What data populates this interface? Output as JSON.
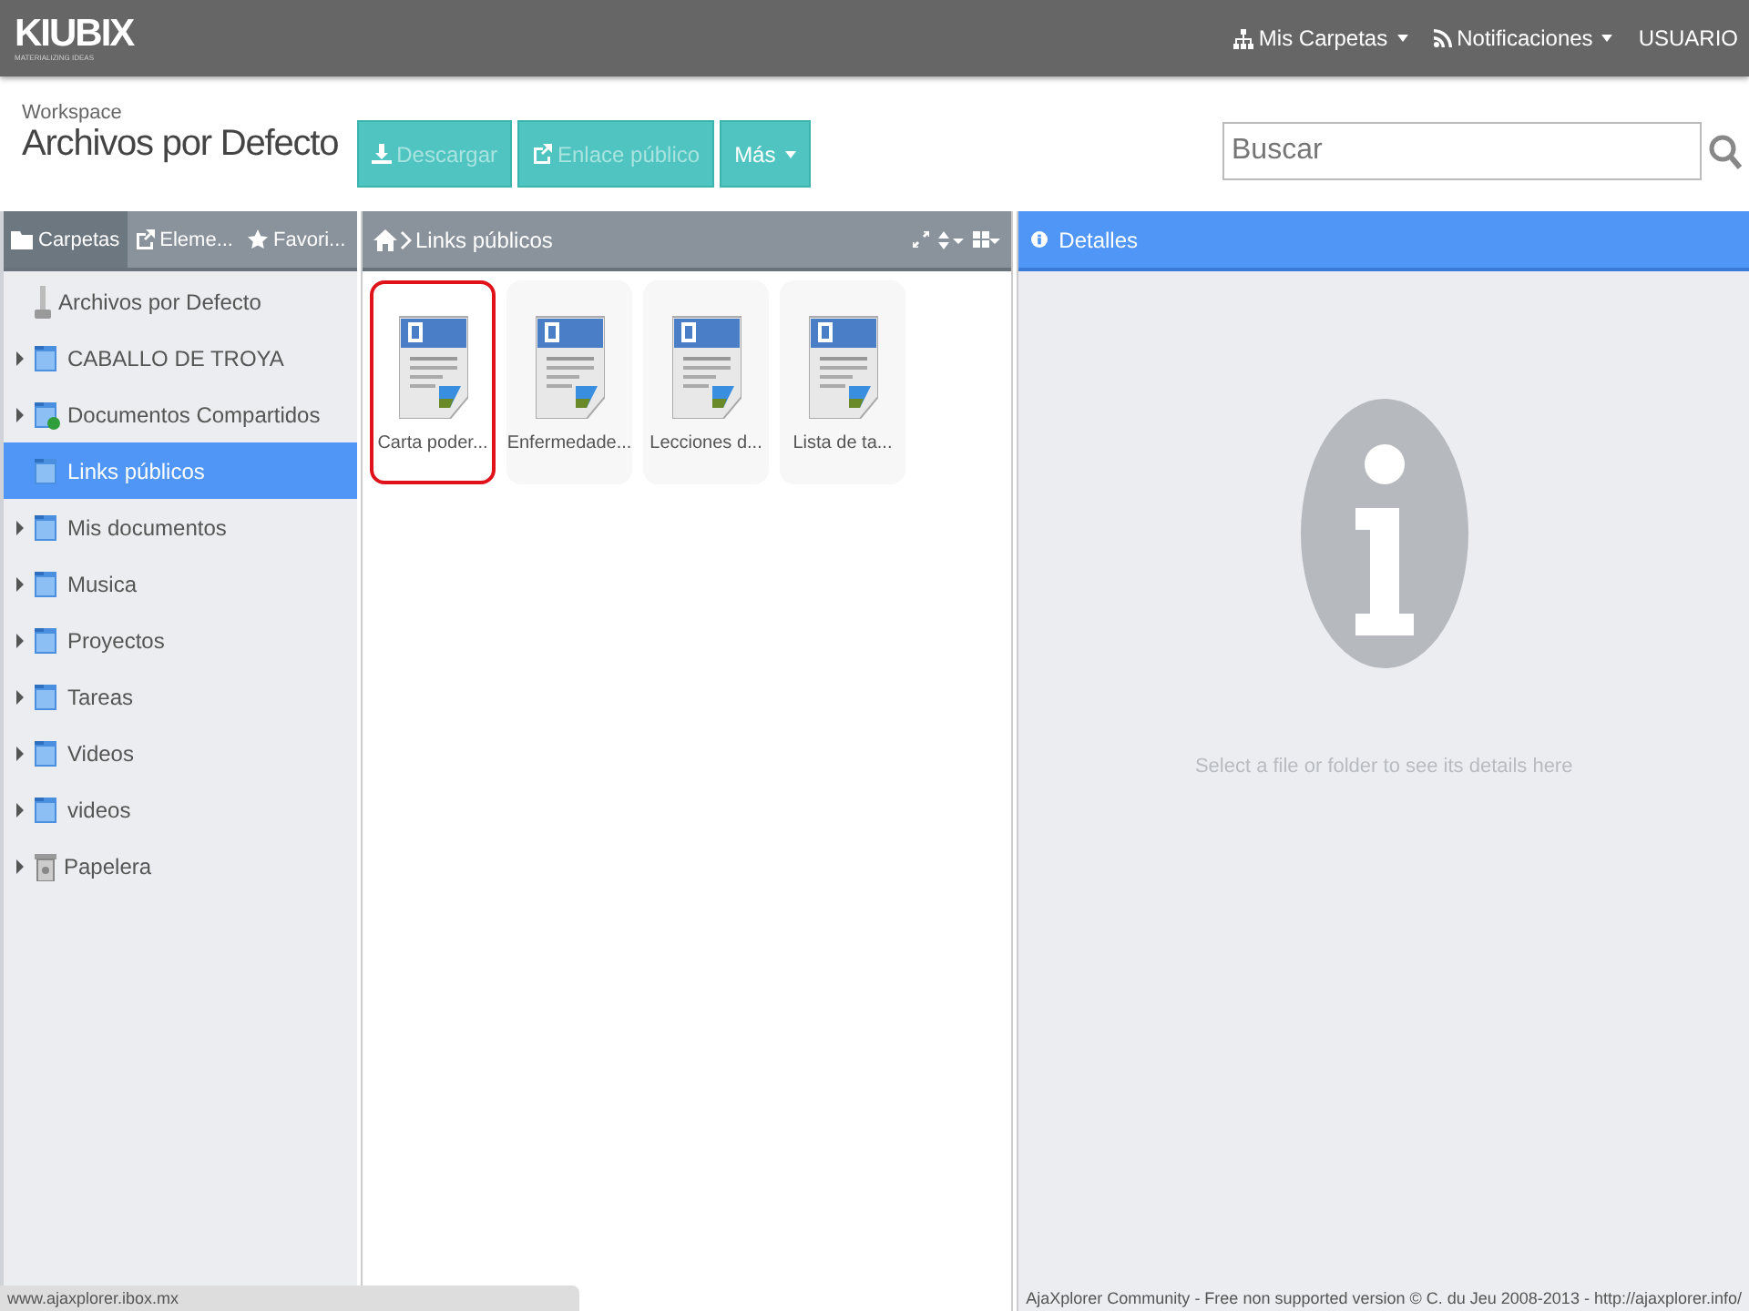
{
  "topbar": {
    "logo": "KIUBIX",
    "logo_tagline": "MATERIALIZING IDEAS",
    "menus": [
      {
        "label": "Mis Carpetas",
        "kind": "sitemap"
      },
      {
        "label": "Notificaciones",
        "kind": "rss"
      }
    ],
    "user": "USUARIO"
  },
  "header": {
    "subtitle": "Workspace",
    "title": "Archivos por Defecto"
  },
  "actions": [
    {
      "label": "Descargar",
      "kind": "download",
      "disabled": true
    },
    {
      "label": "Enlace público",
      "kind": "share",
      "disabled": true
    },
    {
      "label": "Más",
      "kind": "menu",
      "disabled": false
    }
  ],
  "search": {
    "placeholder": "Buscar"
  },
  "sidebar": {
    "tabs": [
      {
        "label": "Carpetas",
        "kind": "folder",
        "selected": true
      },
      {
        "label": "Eleme...",
        "kind": "share",
        "selected": false
      },
      {
        "label": "Favori...",
        "kind": "star",
        "selected": false
      }
    ],
    "tree": {
      "label": "Archivos por Defecto",
      "kind": "root",
      "children": [
        {
          "label": "CABALLO DE TROYA",
          "kind": "folder",
          "expandable": true,
          "selected": false
        },
        {
          "label": "Documentos Compartidos",
          "kind": "shared",
          "expandable": true,
          "selected": false
        },
        {
          "label": "Links públicos",
          "kind": "folder",
          "expandable": false,
          "selected": true
        },
        {
          "label": "Mis documentos",
          "kind": "folder",
          "expandable": true,
          "selected": false
        },
        {
          "label": "Musica",
          "kind": "folder",
          "expandable": true,
          "selected": false
        },
        {
          "label": "Proyectos",
          "kind": "folder",
          "expandable": true,
          "selected": false
        },
        {
          "label": "Tareas",
          "kind": "folder",
          "expandable": true,
          "selected": false
        },
        {
          "label": "Videos",
          "kind": "folder",
          "expandable": true,
          "selected": false
        },
        {
          "label": "videos",
          "kind": "folder",
          "expandable": true,
          "selected": false
        },
        {
          "label": "Papelera",
          "kind": "trash",
          "expandable": true,
          "selected": false
        }
      ]
    }
  },
  "files_panel": {
    "path": "Links públicos",
    "files": [
      {
        "name": "Carta poder...",
        "selected": true
      },
      {
        "name": "Enfermedade...",
        "selected": false
      },
      {
        "name": "Lecciones d...",
        "selected": false
      },
      {
        "name": "Lista de ta...",
        "selected": false
      }
    ]
  },
  "details_panel": {
    "title": "Detalles",
    "empty_message": "Select a file or folder to see its details here"
  },
  "footer": "AjaXplorer Community - Free non supported version © C. du Jeu 2008-2013 - http://ajaxplorer.info/",
  "status_url": "www.ajaxplorer.ibox.mx"
}
